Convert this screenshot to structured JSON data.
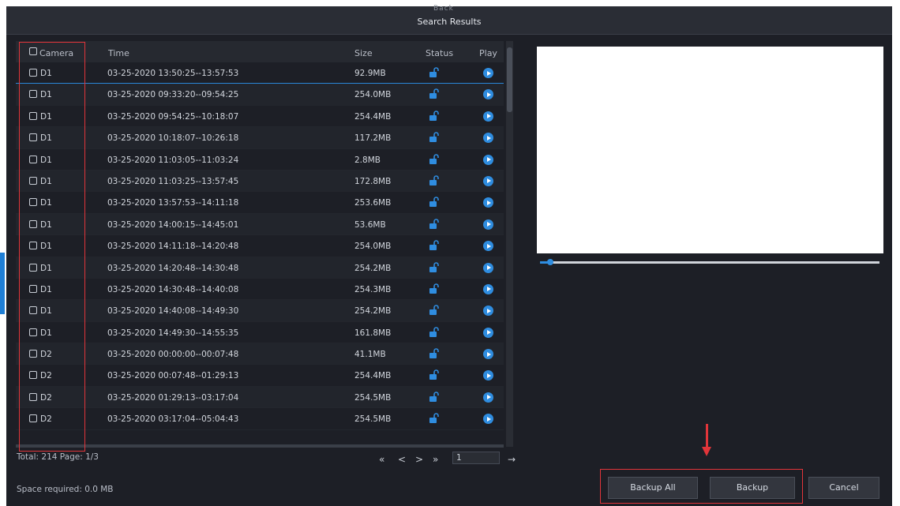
{
  "window": {
    "behind_title": "Back",
    "title": "Search Results"
  },
  "table": {
    "headers": {
      "camera": "Camera",
      "time": "Time",
      "size": "Size",
      "status": "Status",
      "play": "Play"
    },
    "rows": [
      {
        "camera": "D1",
        "time": "03-25-2020 13:50:25--13:57:53",
        "size": "92.9MB"
      },
      {
        "camera": "D1",
        "time": "03-25-2020 09:33:20--09:54:25",
        "size": "254.0MB"
      },
      {
        "camera": "D1",
        "time": "03-25-2020 09:54:25--10:18:07",
        "size": "254.4MB"
      },
      {
        "camera": "D1",
        "time": "03-25-2020 10:18:07--10:26:18",
        "size": "117.2MB"
      },
      {
        "camera": "D1",
        "time": "03-25-2020 11:03:05--11:03:24",
        "size": "2.8MB"
      },
      {
        "camera": "D1",
        "time": "03-25-2020 11:03:25--13:57:45",
        "size": "172.8MB"
      },
      {
        "camera": "D1",
        "time": "03-25-2020 13:57:53--14:11:18",
        "size": "253.6MB"
      },
      {
        "camera": "D1",
        "time": "03-25-2020 14:00:15--14:45:01",
        "size": "53.6MB"
      },
      {
        "camera": "D1",
        "time": "03-25-2020 14:11:18--14:20:48",
        "size": "254.0MB"
      },
      {
        "camera": "D1",
        "time": "03-25-2020 14:20:48--14:30:48",
        "size": "254.2MB"
      },
      {
        "camera": "D1",
        "time": "03-25-2020 14:30:48--14:40:08",
        "size": "254.3MB"
      },
      {
        "camera": "D1",
        "time": "03-25-2020 14:40:08--14:49:30",
        "size": "254.2MB"
      },
      {
        "camera": "D1",
        "time": "03-25-2020 14:49:30--14:55:35",
        "size": "161.8MB"
      },
      {
        "camera": "D2",
        "time": "03-25-2020 00:00:00--00:07:48",
        "size": "41.1MB"
      },
      {
        "camera": "D2",
        "time": "03-25-2020 00:07:48--01:29:13",
        "size": "254.4MB"
      },
      {
        "camera": "D2",
        "time": "03-25-2020 01:29:13--03:17:04",
        "size": "254.5MB"
      },
      {
        "camera": "D2",
        "time": "03-25-2020 03:17:04--05:04:43",
        "size": "254.5MB"
      }
    ]
  },
  "footer": {
    "total": "Total: 214  Page: 1/3",
    "space_required": "Space required: 0.0 MB",
    "pager": {
      "first": "«",
      "prev": "<",
      "next": ">",
      "last": "»",
      "page_value": "1",
      "go": "→"
    }
  },
  "buttons": {
    "backup_all": "Backup All",
    "backup": "Backup",
    "cancel": "Cancel"
  },
  "colors": {
    "accent": "#2f8de0",
    "highlight": "#e2353a",
    "background": "#1d1f26"
  },
  "icons": {
    "status": "unlock-icon",
    "play": "play-circle-icon"
  }
}
